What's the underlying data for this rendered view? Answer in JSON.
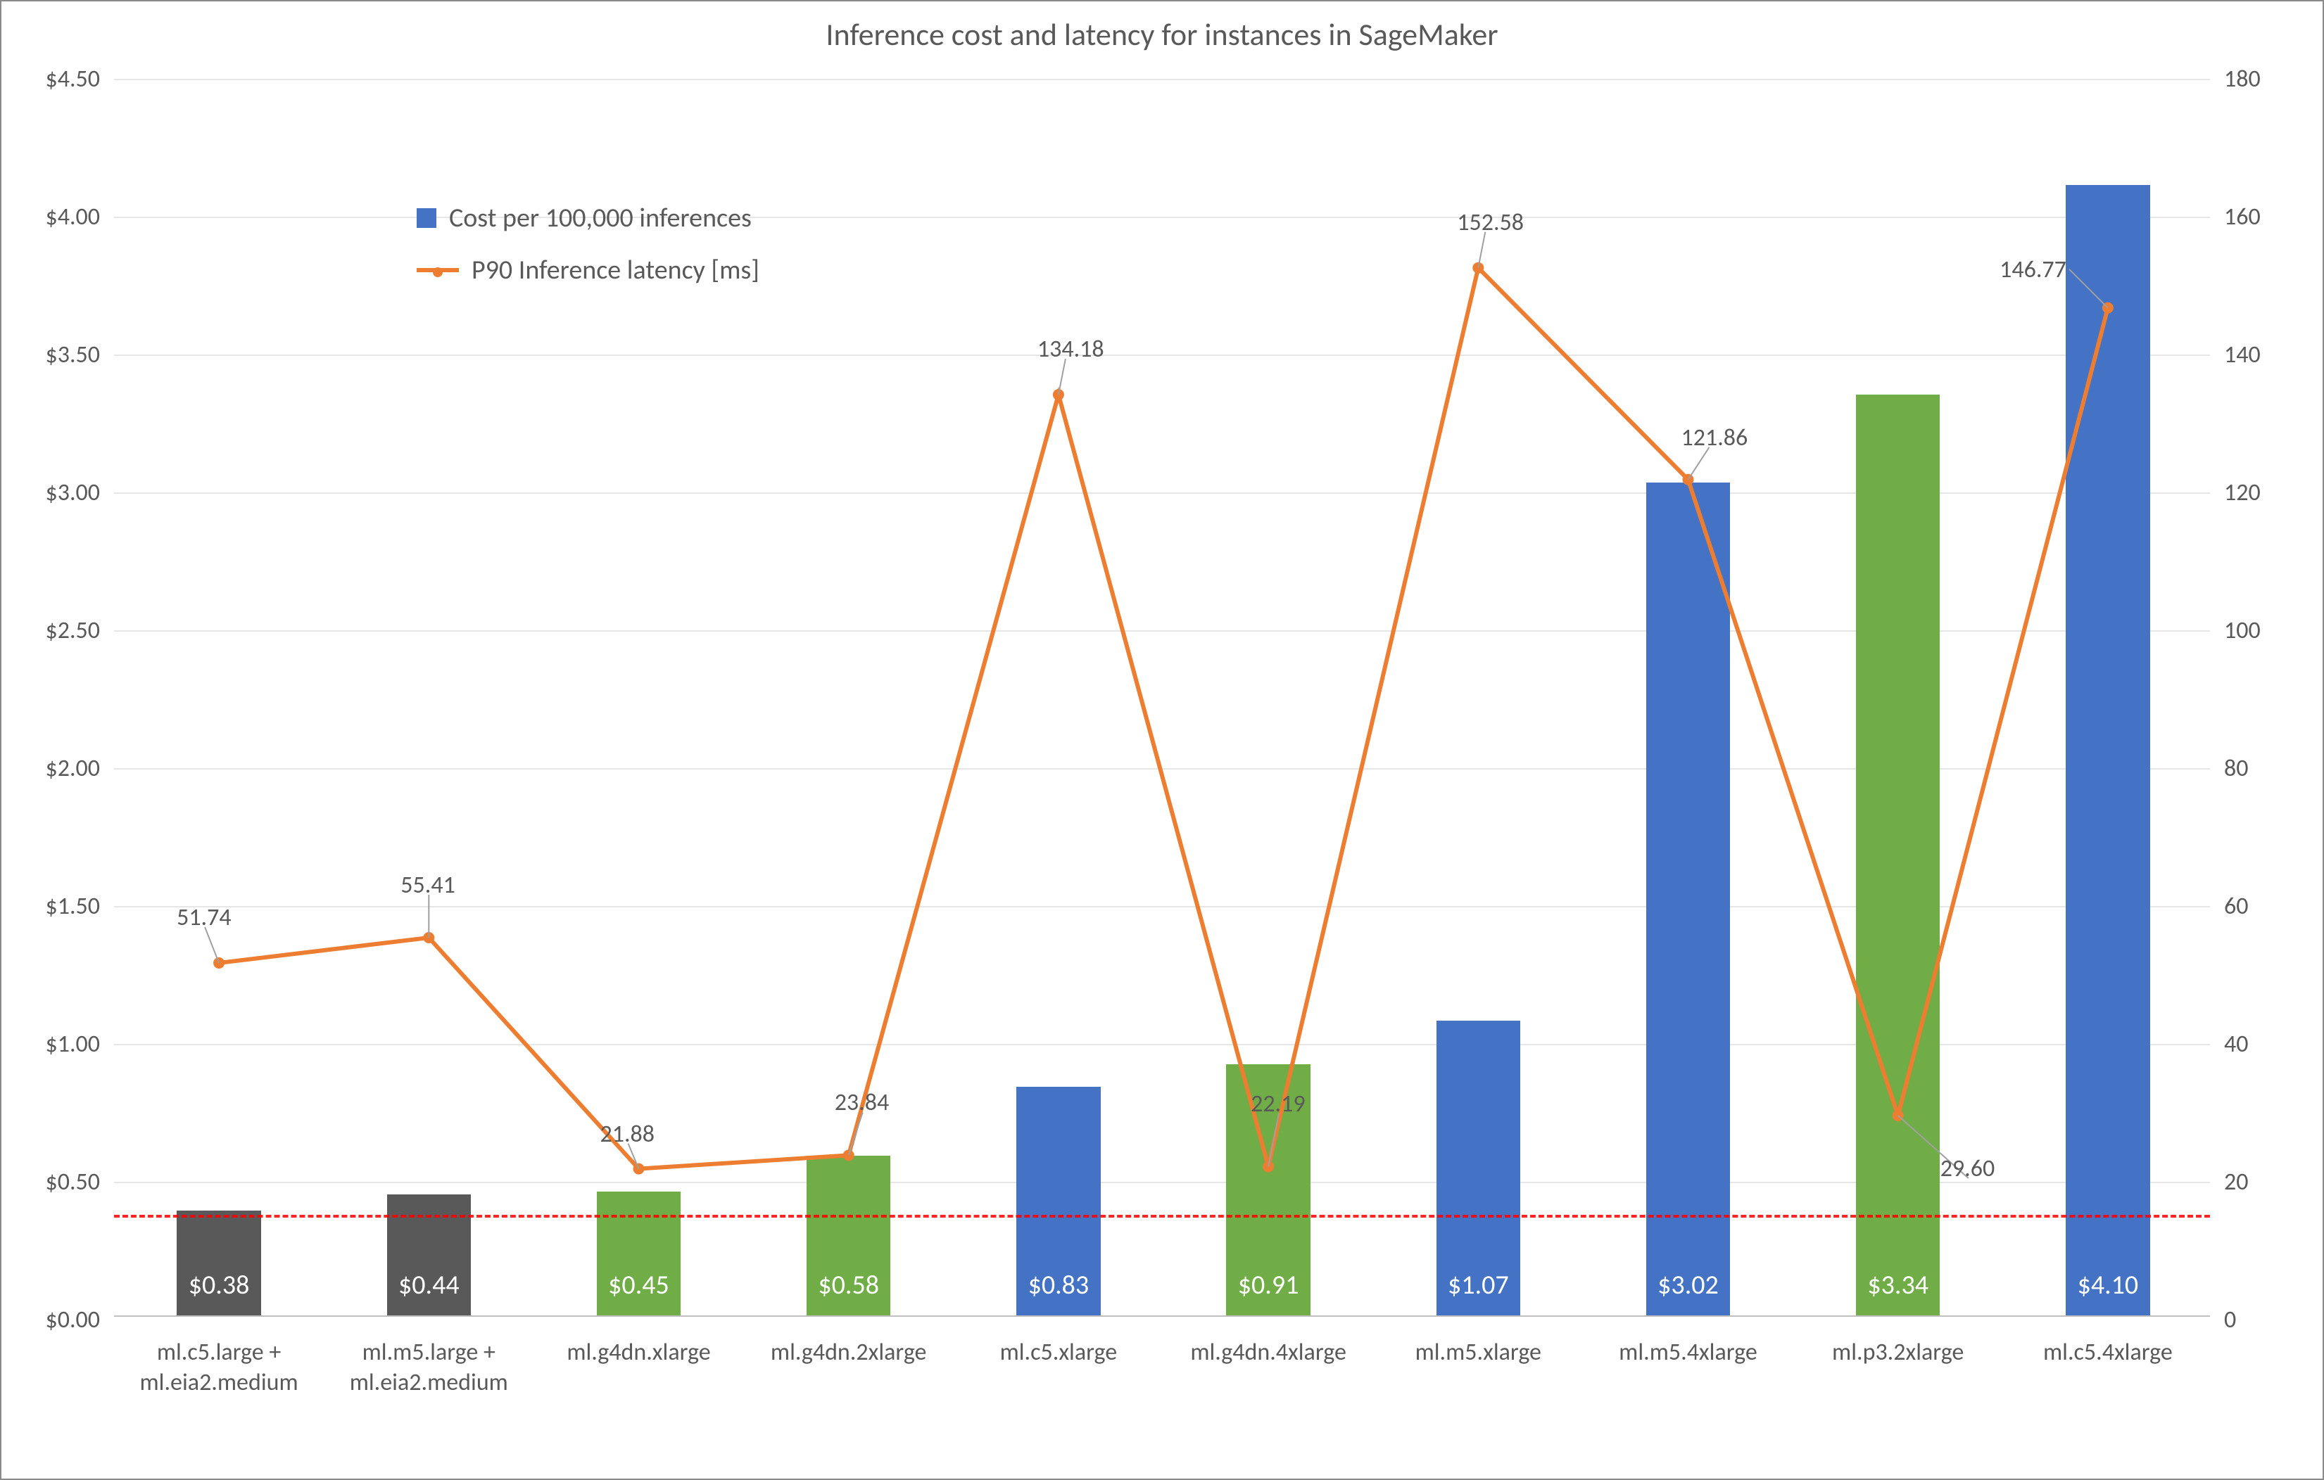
{
  "chart_data": {
    "type": "bar+line",
    "title": "Inference cost and latency for instances in SageMaker",
    "categories": [
      "ml.c5.large +\nml.eia2.medium",
      "ml.m5.large +\nml.eia2.medium",
      "ml.g4dn.xlarge",
      "ml.g4dn.2xlarge",
      "ml.c5.xlarge",
      "ml.g4dn.4xlarge",
      "ml.m5.xlarge",
      "ml.m5.4xlarge",
      "ml.p3.2xlarge",
      "ml.c5.4xlarge"
    ],
    "series": [
      {
        "name": "Cost per 100,000 inferences",
        "type": "bar",
        "axis": "left",
        "values": [
          0.38,
          0.44,
          0.45,
          0.58,
          0.83,
          0.91,
          1.07,
          3.02,
          3.34,
          4.1
        ],
        "value_labels": [
          "$0.38",
          "$0.44",
          "$0.45",
          "$0.58",
          "$0.83",
          "$0.91",
          "$1.07",
          "$3.02",
          "$3.34",
          "$4.10"
        ],
        "bar_colors": [
          "gray",
          "gray",
          "green",
          "green",
          "blue",
          "green",
          "blue",
          "blue",
          "green",
          "blue"
        ]
      },
      {
        "name": "P90 Inference latency [ms]",
        "type": "line",
        "axis": "right",
        "values": [
          51.74,
          55.41,
          21.88,
          23.84,
          134.18,
          22.19,
          152.58,
          121.86,
          29.6,
          146.77
        ],
        "value_labels": [
          "51.74",
          "55.41",
          "21.88",
          "23.84",
          "134.18",
          "22.19",
          "152.58",
          "121.86",
          "29.60",
          "146.77"
        ],
        "color": "#ed7d31"
      }
    ],
    "left_axis": {
      "label": "",
      "min": 0,
      "max": 4.5,
      "ticks": [
        "$0.00",
        "$0.50",
        "$1.00",
        "$1.50",
        "$2.00",
        "$2.50",
        "$3.00",
        "$3.50",
        "$4.00",
        "$4.50"
      ]
    },
    "right_axis": {
      "label": "",
      "min": 0,
      "max": 180,
      "ticks": [
        "0",
        "20",
        "40",
        "60",
        "80",
        "100",
        "120",
        "140",
        "160",
        "180"
      ]
    },
    "reference_line": {
      "axis": "left",
      "value": 0.38,
      "style": "red-dashed"
    },
    "legend_position": "top-left-inside"
  },
  "legend": {
    "cost_label": "Cost per 100,000 inferences",
    "latency_label": "P90 Inference latency [ms]"
  }
}
